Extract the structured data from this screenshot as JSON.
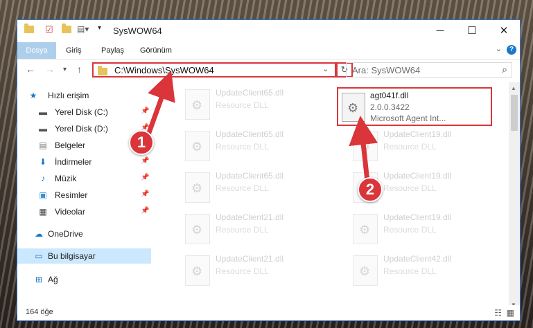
{
  "title": "SysWOW64",
  "ribbon": {
    "tabs": [
      "Dosya",
      "Giriş",
      "Paylaş",
      "Görünüm"
    ]
  },
  "nav": {
    "address": "C:\\Windows\\SysWOW64",
    "search_placeholder": "Ara: SysWOW64"
  },
  "sidebar": {
    "items": [
      {
        "label": "Hızlı erişim",
        "icon": "star-icon",
        "pinned": false
      },
      {
        "label": "Yerel Disk (C:)",
        "icon": "drive-icon",
        "pinned": true
      },
      {
        "label": "Yerel Disk (D:)",
        "icon": "drive-icon",
        "pinned": true
      },
      {
        "label": "Belgeler",
        "icon": "documents-icon",
        "pinned": true
      },
      {
        "label": "İndirmeler",
        "icon": "download-icon",
        "pinned": true
      },
      {
        "label": "Müzik",
        "icon": "music-icon",
        "pinned": true
      },
      {
        "label": "Resimler",
        "icon": "pictures-icon",
        "pinned": true
      },
      {
        "label": "Videolar",
        "icon": "video-icon",
        "pinned": true
      },
      {
        "label": "OneDrive",
        "icon": "cloud-icon",
        "pinned": false
      },
      {
        "label": "Bu bilgisayar",
        "icon": "computer-icon",
        "pinned": false,
        "selected": true
      },
      {
        "label": "Ağ",
        "icon": "network-icon",
        "pinned": false
      }
    ]
  },
  "files": {
    "left": [
      {
        "name": "UpdateClient65.dll",
        "desc": "Resource DLL"
      },
      {
        "name": "UpdateClient65.dll",
        "desc": "Resource DLL"
      },
      {
        "name": "UpdateClient65.dll",
        "desc": "Resource DLL"
      },
      {
        "name": "UpdateClient21.dll",
        "desc": "Resource DLL"
      },
      {
        "name": "UpdateClient21.dll",
        "desc": "Resource DLL"
      }
    ],
    "right": [
      {
        "name": "UpdateClient19.dll",
        "desc": "Resource DLL"
      },
      {
        "name": "UpdateClient19.dll",
        "desc": "Resource DLL"
      },
      {
        "name": "UpdateClient19.dll",
        "desc": "Resource DLL"
      },
      {
        "name": "UpdateClient42.dll",
        "desc": "Resource DLL"
      }
    ],
    "target": {
      "name": "agt041f.dll",
      "version": "2.0.0.3422",
      "company": "Microsoft Agent Int..."
    }
  },
  "status": {
    "count": "164 öğe"
  },
  "annotations": {
    "step1": "1",
    "step2": "2",
    "color": "#d9353b"
  }
}
